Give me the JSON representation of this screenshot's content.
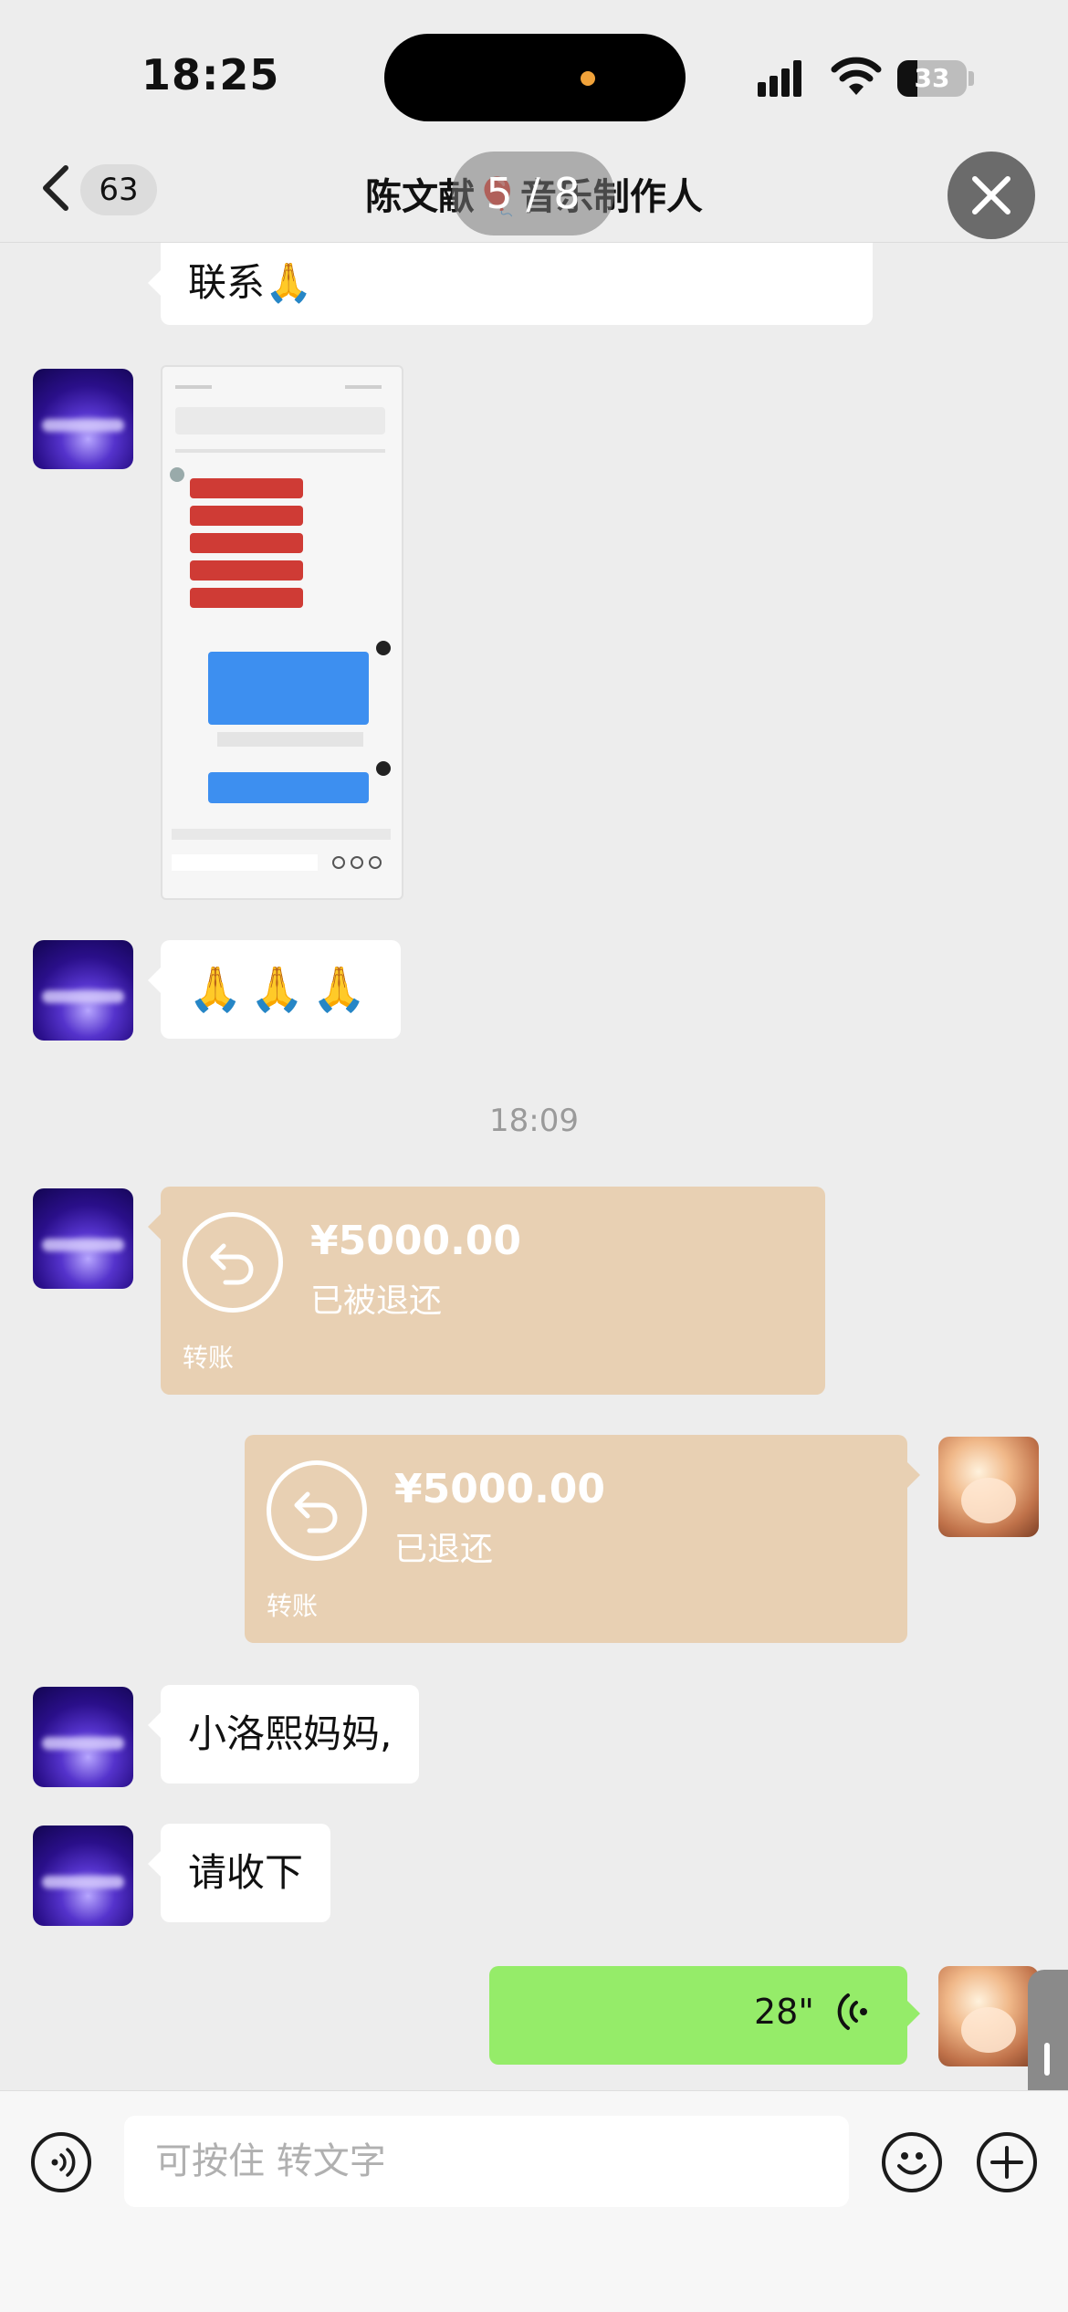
{
  "status_bar": {
    "time": "18:25",
    "battery": "33"
  },
  "nav": {
    "unread_count": "63",
    "title": "陈文献🎈音乐制作人",
    "page_counter": "5 / 8"
  },
  "messages": {
    "partial_text": "联系🙏",
    "emoji_text": "🙏🙏🙏",
    "timestamp": "18:09",
    "transfer_in": {
      "amount": "¥5000.00",
      "status": "已被退还",
      "type": "转账"
    },
    "transfer_out": {
      "amount": "¥5000.00",
      "status": "已退还",
      "type": "转账"
    },
    "text_1": "小洛熙妈妈,",
    "text_2": "请收下",
    "voice_duration": "28\""
  },
  "input_bar": {
    "placeholder": "可按住 转文字"
  },
  "icons": {
    "back": "chevron-left-icon",
    "close": "close-icon",
    "voice_mode": "voice-icon",
    "emoji": "emoji-icon",
    "more": "plus-icon"
  },
  "colors": {
    "chat_bg": "#ededed",
    "transfer_card": "#e8d0b3",
    "voice_bubble": "#95ec69"
  }
}
